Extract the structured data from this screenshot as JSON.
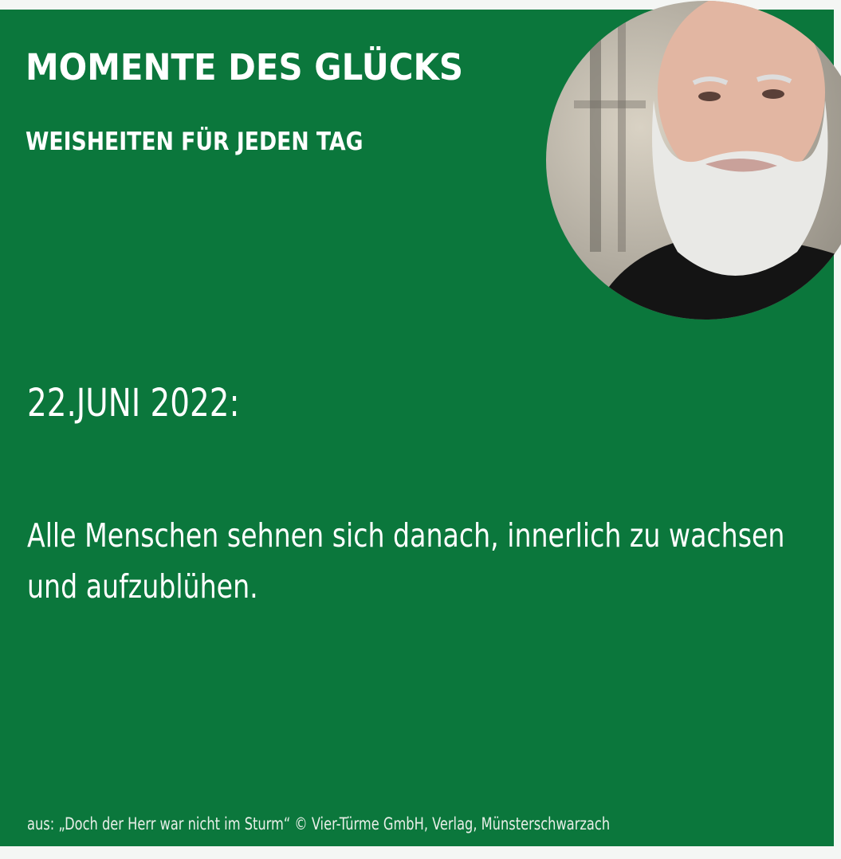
{
  "header": {
    "title": "MOMENTE DES GLÜCKS",
    "subtitle": "WEISHEITEN FÜR JEDEN TAG"
  },
  "date": "22.JUNI 2022:",
  "quote": "Alle Menschen sehnen sich danach, innerlich zu wachsen und aufzublühen.",
  "footer": "aus: „Doch der Herr war nicht im Sturm“ © Vier-Türme GmbH, Verlag, Münsterschwarzach",
  "colors": {
    "panel_green": "#0b773c",
    "text": "#ffffff",
    "border": "#f4f6f4"
  }
}
